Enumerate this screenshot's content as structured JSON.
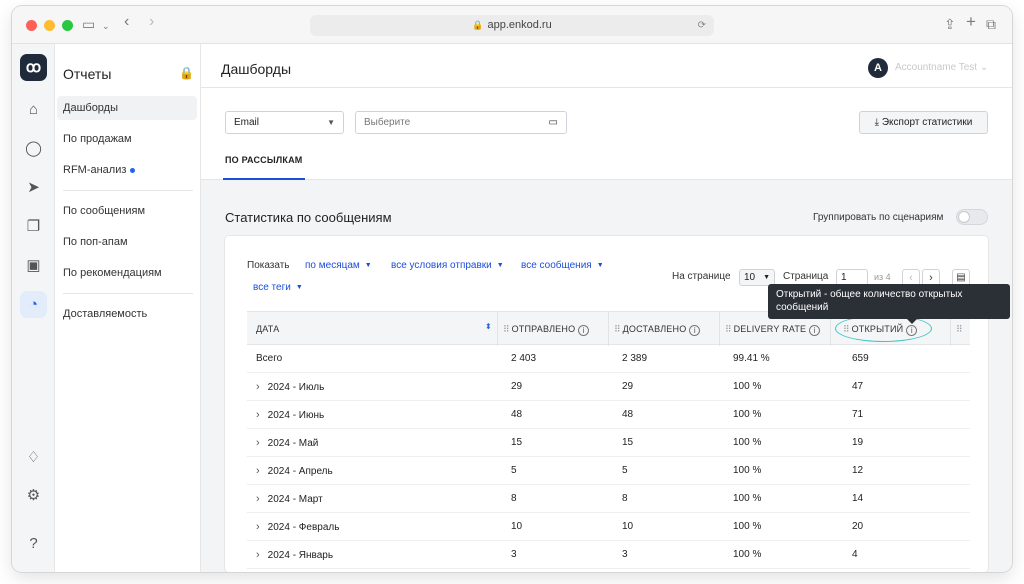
{
  "browser": {
    "url": "app.enkod.ru",
    "traffic_colors": [
      "#fe5f57",
      "#febc2e",
      "#28c840"
    ]
  },
  "rail": {
    "logo": "ꝏ",
    "icons": [
      "home-icon",
      "user-icon",
      "send-icon",
      "messages-icon",
      "bag-icon",
      "chart-pie-icon",
      "bell-icon",
      "gear-icon",
      "help-icon"
    ]
  },
  "sidebar": {
    "title": "Отчеты",
    "items": [
      {
        "label": "Дашборды"
      },
      {
        "label": "По продажам"
      },
      {
        "label": "RFM-анализ"
      },
      {
        "label": "По сообщениям"
      },
      {
        "label": "По поп-апам"
      },
      {
        "label": "По рекомендациям"
      },
      {
        "label": "Доставляемость"
      }
    ]
  },
  "header": {
    "title": "Дашборды",
    "avatar_letter": "A",
    "user_name": "Accountname Test"
  },
  "filters": {
    "channel": "Email",
    "date_placeholder": "Выберите",
    "export_label": "Экспорт статистики",
    "tab": "ПО РАССЫЛКАМ"
  },
  "section": {
    "title": "Статистика по сообщениям",
    "group_label": "Группировать по сценариям"
  },
  "toolbar": {
    "show_label": "Показать",
    "by_months": "по месяцам",
    "send_conditions": "все условия отправки",
    "all_messages": "все сообщения",
    "all_tags": "все теги",
    "per_page_label": "На странице",
    "per_page_value": "10",
    "page_label": "Страница",
    "page_value": "1",
    "of_label": "из 4"
  },
  "table": {
    "columns": [
      "ДАТА",
      "ОТПРАВЛЕНО",
      "ДОСТАВЛЕНО",
      "DELIVERY RATE",
      "ОТКРЫТИЙ"
    ],
    "rows": [
      {
        "date": "Всего",
        "sent": "2 403",
        "delivered": "2 389",
        "rate": "99.41 %",
        "opens": "659"
      },
      {
        "date": "2024 - Июль",
        "sent": "29",
        "delivered": "29",
        "rate": "100 %",
        "opens": "47"
      },
      {
        "date": "2024 - Июнь",
        "sent": "48",
        "delivered": "48",
        "rate": "100 %",
        "opens": "71"
      },
      {
        "date": "2024 - Май",
        "sent": "15",
        "delivered": "15",
        "rate": "100 %",
        "opens": "19"
      },
      {
        "date": "2024 - Апрель",
        "sent": "5",
        "delivered": "5",
        "rate": "100 %",
        "opens": "12"
      },
      {
        "date": "2024 - Март",
        "sent": "8",
        "delivered": "8",
        "rate": "100 %",
        "opens": "14"
      },
      {
        "date": "2024 - Февраль",
        "sent": "10",
        "delivered": "10",
        "rate": "100 %",
        "opens": "20"
      },
      {
        "date": "2024 - Январь",
        "sent": "3",
        "delivered": "3",
        "rate": "100 %",
        "opens": "4"
      }
    ]
  },
  "tooltip": {
    "text": "Открытий - общее количество открытых сообщений"
  },
  "colors": {
    "accent": "#1d4ed8",
    "highlight": "#3fc4c4"
  }
}
